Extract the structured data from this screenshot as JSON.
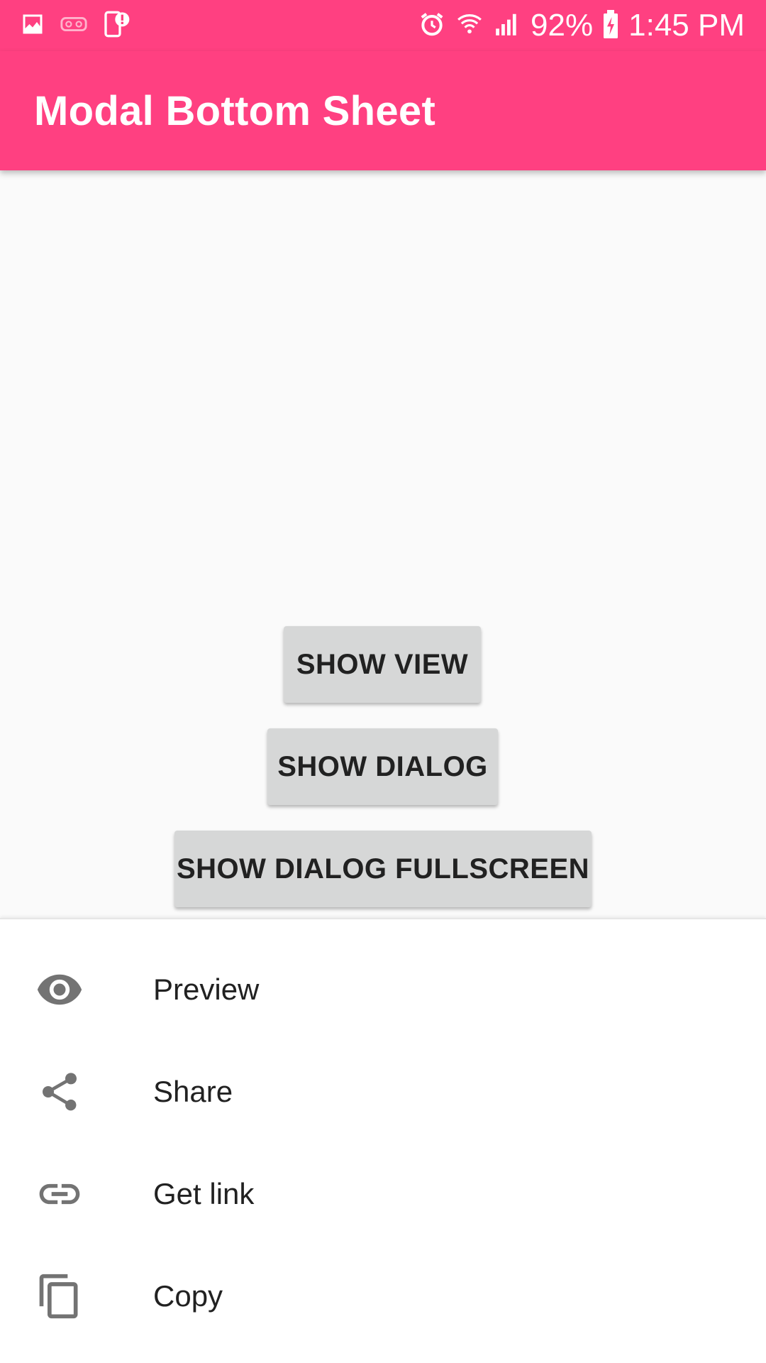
{
  "status_bar": {
    "left_icons": [
      "gallery-icon",
      "vr-headset-icon",
      "phone-alert-icon"
    ],
    "right_icons": [
      "alarm-icon",
      "wifi-icon",
      "signal-icon"
    ],
    "battery_percent": "92%",
    "battery_icon": "battery-charging-icon",
    "time": "1:45 PM"
  },
  "app_bar": {
    "title": "Modal Bottom Sheet",
    "color": "#ff4081"
  },
  "buttons": {
    "show_view": "SHOW VIEW",
    "show_dialog": "SHOW DIALOG",
    "show_dialog_fullscreen": "SHOW DIALOG FULLSCREEN"
  },
  "bottom_sheet": {
    "items": [
      {
        "label": "Preview",
        "icon": "eye-icon"
      },
      {
        "label": "Share",
        "icon": "share-icon"
      },
      {
        "label": "Get link",
        "icon": "link-icon"
      },
      {
        "label": "Copy",
        "icon": "copy-icon"
      }
    ]
  }
}
